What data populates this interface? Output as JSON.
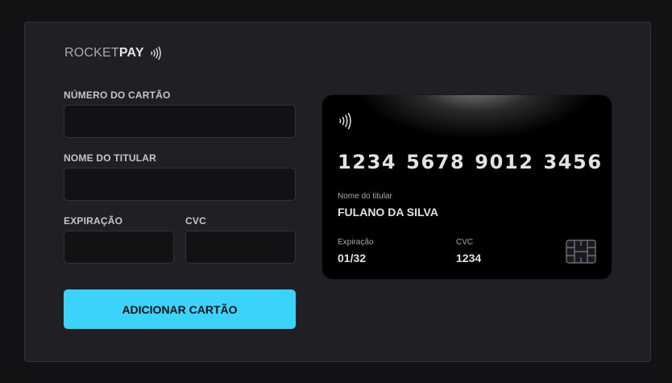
{
  "logo": {
    "prefix": "ROCKET",
    "suffix": "PAY"
  },
  "form": {
    "card_number_label": "NÚMERO DO CARTÃO",
    "card_number_value": "",
    "holder_label": "NOME DO TITULAR",
    "holder_value": "",
    "expiration_label": "EXPIRAÇÃO",
    "expiration_value": "",
    "cvc_label": "CVC",
    "cvc_value": "",
    "submit_label": "ADICIONAR CARTÃO"
  },
  "card": {
    "number": "1234 5678 9012 3456",
    "holder_caption": "Nome do titular",
    "holder_name": "FULANO DA SILVA",
    "expiration_caption": "Expiração",
    "expiration_value": "01/32",
    "cvc_caption": "CVC",
    "cvc_value": "1234"
  },
  "colors": {
    "background": "#121214",
    "panel": "#202024",
    "accent": "#3cd3fb",
    "card": "#000000"
  },
  "icons": {
    "logo_nfc": "contactless-icon",
    "card_nfc": "contactless-icon",
    "chip": "card-chip-icon"
  }
}
